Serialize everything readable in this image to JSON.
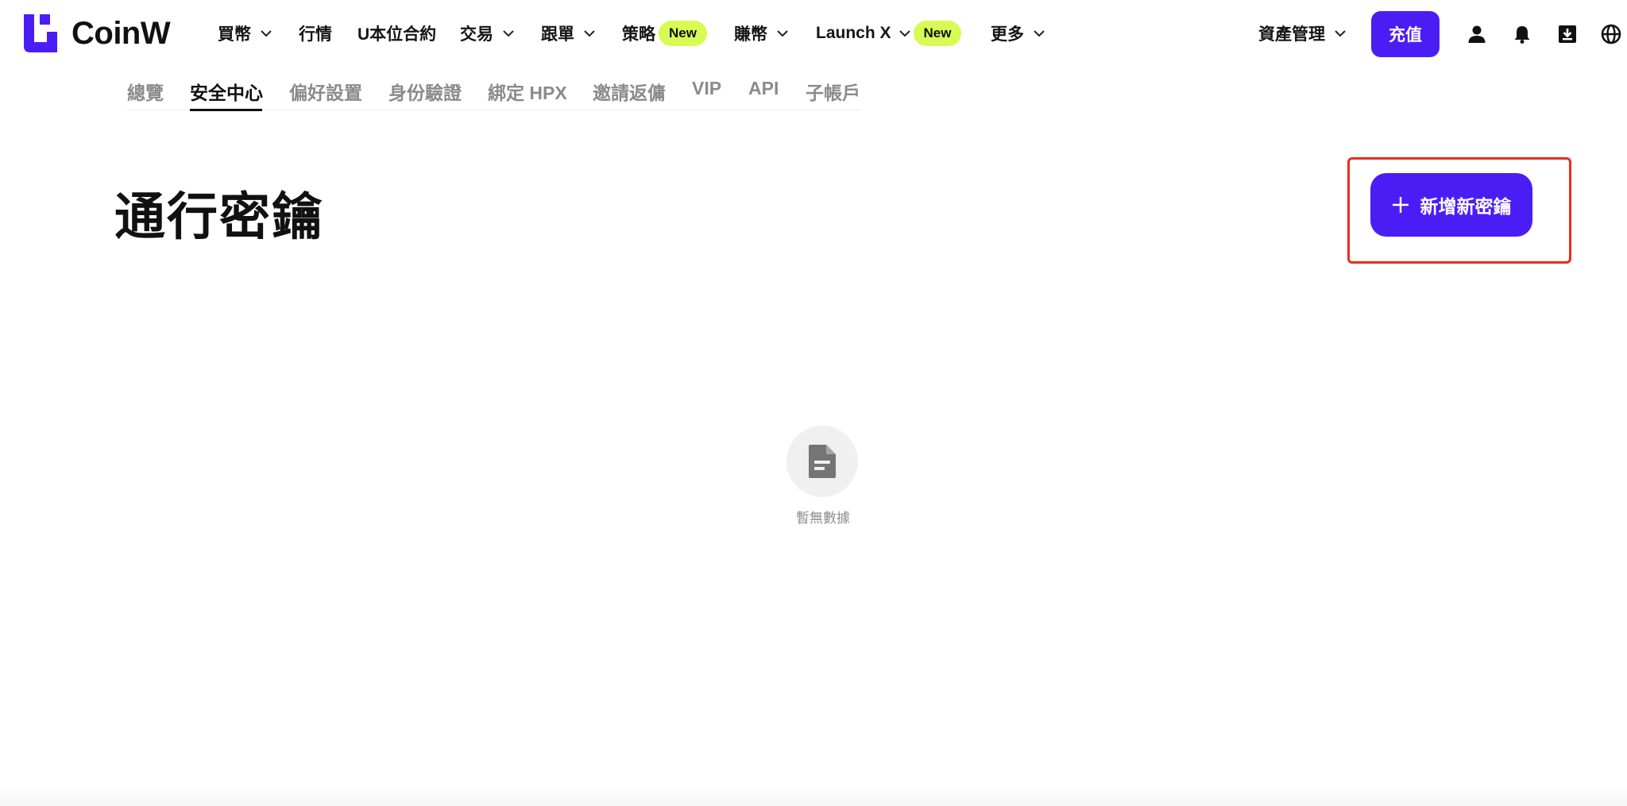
{
  "brand": {
    "name": "CoinW",
    "accent": "#4b1df5",
    "badge_color": "#d7fb54",
    "highlight_color": "#ee2a1e"
  },
  "nav": {
    "items": [
      {
        "label": "買幣",
        "has_dropdown": true
      },
      {
        "label": "行情",
        "has_dropdown": false
      },
      {
        "label": "U本位合約",
        "has_dropdown": false
      },
      {
        "label": "交易",
        "has_dropdown": true
      },
      {
        "label": "跟單",
        "has_dropdown": true
      },
      {
        "label": "策略",
        "has_dropdown": false,
        "badge": "New"
      },
      {
        "label": "賺幣",
        "has_dropdown": true
      },
      {
        "label": "Launch X",
        "has_dropdown": true,
        "badge": "New"
      },
      {
        "label": "更多",
        "has_dropdown": true
      }
    ],
    "asset_management": "資產管理",
    "deposit": "充值",
    "icons": [
      "user-icon",
      "bell-icon",
      "download-icon",
      "globe-icon"
    ]
  },
  "tabs": {
    "items": [
      "總覽",
      "安全中心",
      "偏好設置",
      "身份驗證",
      "綁定 HPX",
      "邀請返傭",
      "VIP",
      "API",
      "子帳戶"
    ],
    "active": "安全中心"
  },
  "page": {
    "title": "通行密鑰",
    "add_button": "新增新密鑰",
    "empty_text": "暫無數據"
  }
}
